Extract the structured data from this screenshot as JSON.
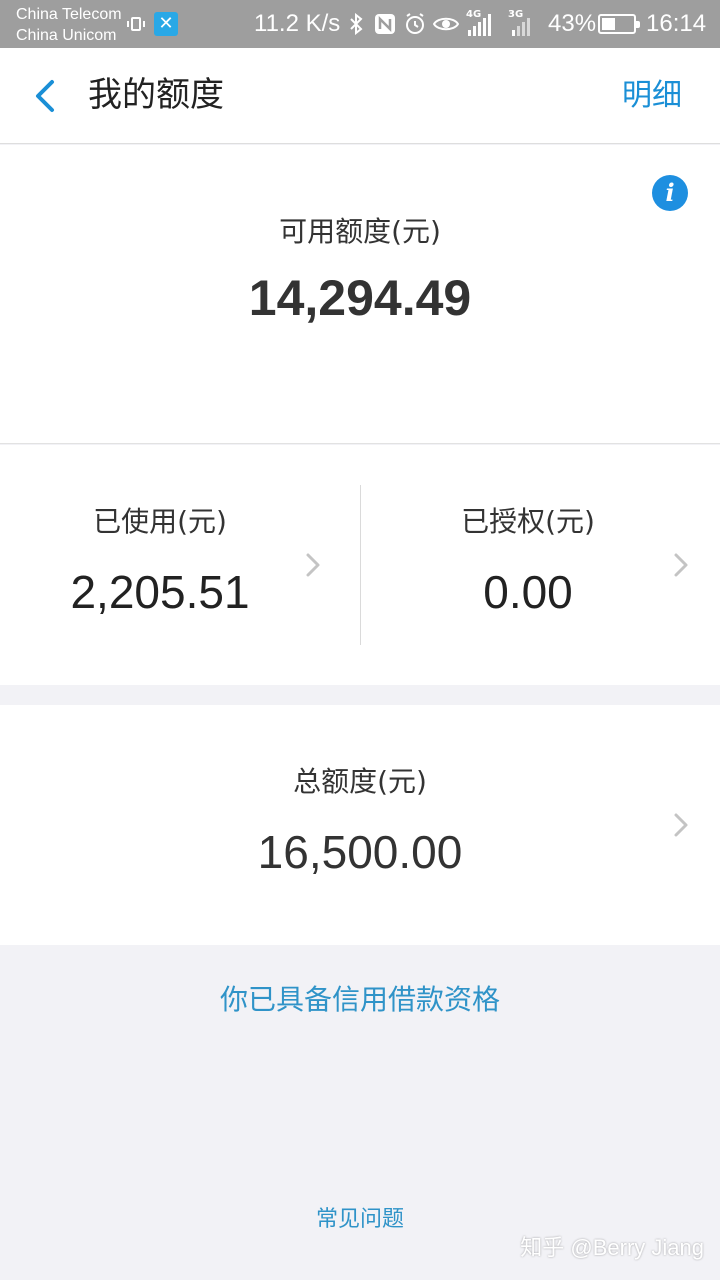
{
  "status_bar": {
    "carrier_1": "China Telecom",
    "carrier_2": "China Unicom",
    "network_speed": "11.2 K/s",
    "network_1": "4G",
    "network_2": "3G",
    "battery_percent": "43%",
    "battery_level": 0.43,
    "time": "16:14",
    "icons": [
      "vibrate-icon",
      "app-notification-icon",
      "bluetooth-icon",
      "nfc-icon",
      "alarm-icon",
      "eye-comfort-icon",
      "signal-icon",
      "battery-icon"
    ]
  },
  "nav": {
    "title": "我的额度",
    "detail_link": "明细"
  },
  "available": {
    "label": "可用额度(元)",
    "value": "14,294.49"
  },
  "used": {
    "label": "已使用(元)",
    "value": "2,205.51"
  },
  "authorized": {
    "label": "已授权(元)",
    "value": "0.00"
  },
  "total": {
    "label": "总额度(元)",
    "value": "16,500.00"
  },
  "eligibility_text": "你已具备信用借款资格",
  "faq_link": "常见问题",
  "watermark": "知乎 @Berry Jiang",
  "colors": {
    "accent": "#1a8fd6",
    "link": "#2f93c8",
    "info_icon": "#1e8fe0",
    "background": "#f2f2f6"
  }
}
